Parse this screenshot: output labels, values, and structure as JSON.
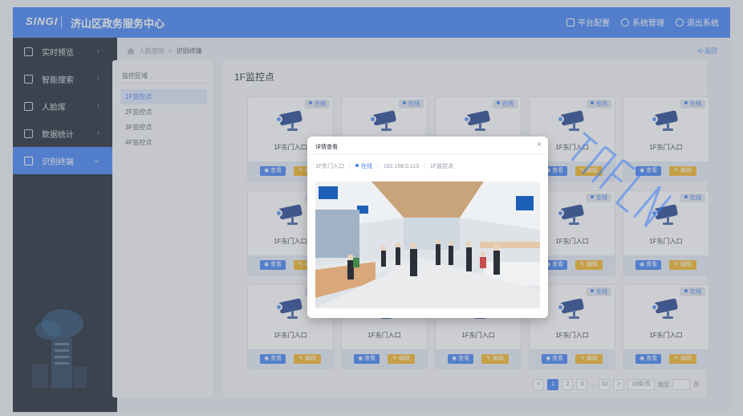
{
  "header": {
    "logo": "SINGI",
    "title": "济山区政务服务中心",
    "nav": [
      {
        "label": "平台配置",
        "icon": "layers-icon"
      },
      {
        "label": "系统管理",
        "icon": "gear-icon"
      },
      {
        "label": "退出系统",
        "icon": "power-icon"
      }
    ]
  },
  "sidebar": {
    "items": [
      {
        "label": "实时预览",
        "icon": "monitor-icon"
      },
      {
        "label": "智能搜索",
        "icon": "search-doc-icon"
      },
      {
        "label": "人脸库",
        "icon": "face-scan-icon"
      },
      {
        "label": "数据统计",
        "icon": "line-chart-icon"
      },
      {
        "label": "识别终端",
        "icon": "terminal-icon",
        "active": true
      }
    ]
  },
  "breadcrumb": {
    "parent": "人脸感知",
    "separator": ">",
    "current": "识别终端",
    "back": "返回"
  },
  "zones": {
    "title": "监控区域",
    "items": [
      "1F监控点",
      "2F监控点",
      "3F监控点",
      "4F监控点"
    ],
    "selected": 0
  },
  "main": {
    "title": "1F监控点",
    "card_status": "在线",
    "card_name": "1F东门入口",
    "view_label": "查看",
    "edit_label": "编辑",
    "card_count": 15
  },
  "pagination": {
    "pages": [
      "1",
      "2",
      "3",
      "...",
      "10"
    ],
    "active": "1",
    "prev": "<",
    "next": ">",
    "page_size": "15条/页",
    "jump_label": "跳至",
    "page_unit": "页"
  },
  "modal": {
    "title": "详情查看",
    "close": "×",
    "device_name": "1F东门入口",
    "status": "在线",
    "ip": "192.168.0.113",
    "area": "1F监控点"
  },
  "colors": {
    "primary": "#3d7ef5",
    "sidebar_bg": "#161f2d",
    "edit": "#f5b51f",
    "camera": "#1d3f8f"
  }
}
